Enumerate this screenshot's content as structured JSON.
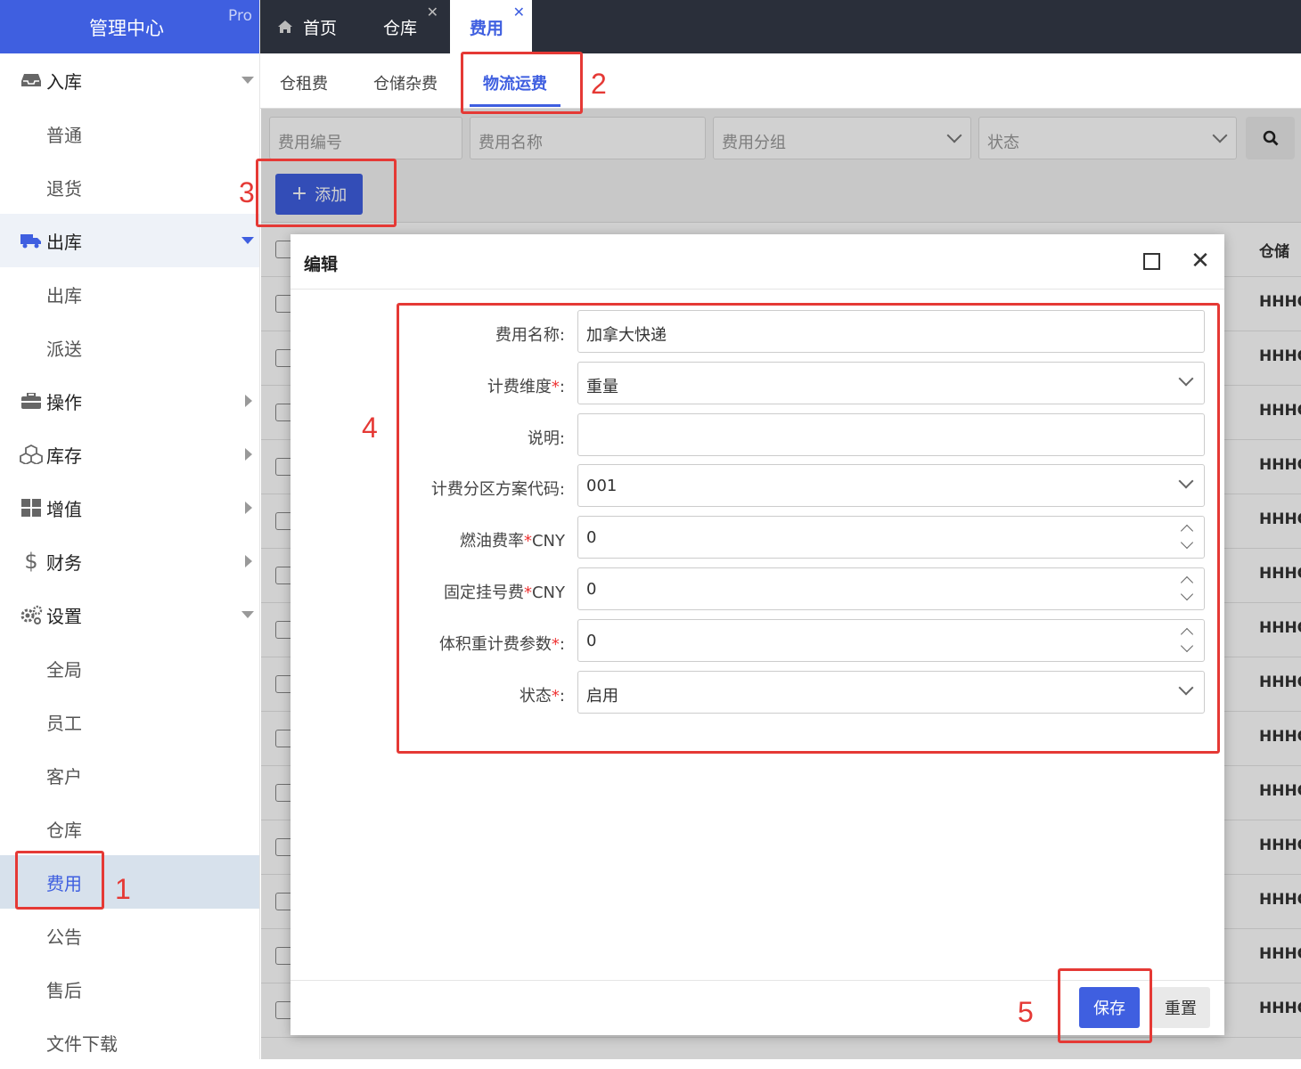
{
  "brand": {
    "title": "管理中心",
    "badge": "Pro"
  },
  "sidebar": {
    "groups": [
      {
        "label": "入库",
        "icon": "inbox-icon",
        "expanded": true,
        "children": [
          "普通",
          "退货"
        ]
      },
      {
        "label": "出库",
        "icon": "truck-icon",
        "expanded": true,
        "active": true,
        "children": [
          "出库",
          "派送"
        ]
      },
      {
        "label": "操作",
        "icon": "briefcase-icon",
        "expanded": false,
        "children": []
      },
      {
        "label": "库存",
        "icon": "cubes-icon",
        "expanded": false,
        "children": []
      },
      {
        "label": "增值",
        "icon": "grid-icon",
        "expanded": false,
        "children": []
      },
      {
        "label": "财务",
        "icon": "dollar-icon",
        "expanded": false,
        "children": []
      },
      {
        "label": "设置",
        "icon": "gears-icon",
        "expanded": true,
        "children": [
          "全局",
          "员工",
          "客户",
          "仓库",
          "费用",
          "公告",
          "售后",
          "文件下载"
        ],
        "selected_child": "费用"
      }
    ]
  },
  "top_tabs": [
    {
      "label": "首页",
      "icon": "home-icon",
      "closable": false
    },
    {
      "label": "仓库",
      "closable": true
    },
    {
      "label": "费用",
      "closable": true,
      "active": true
    }
  ],
  "sub_tabs": [
    {
      "label": "仓租费"
    },
    {
      "label": "仓储杂费"
    },
    {
      "label": "物流运费",
      "active": true
    }
  ],
  "filters": {
    "code_placeholder": "费用编号",
    "name_placeholder": "费用名称",
    "group_placeholder": "费用分组",
    "status_placeholder": "状态"
  },
  "toolbar": {
    "add_label": "添加"
  },
  "table": {
    "header_col": "仓储",
    "row_cell": "HHHC",
    "row_count": 14
  },
  "modal": {
    "title": "编辑",
    "fields": [
      {
        "label": "费用名称:",
        "required": false,
        "value": "加拿大快递",
        "kind": "text"
      },
      {
        "label": "计费维度",
        "required": true,
        "suffix": ":",
        "value": "重量",
        "kind": "select"
      },
      {
        "label": "说明:",
        "required": false,
        "value": "",
        "kind": "text"
      },
      {
        "label": "计费分区方案代码:",
        "required": false,
        "value": "001",
        "kind": "select"
      },
      {
        "label": "燃油费率",
        "required": true,
        "suffix": "CNY",
        "value": "0",
        "kind": "number"
      },
      {
        "label": "固定挂号费",
        "required": true,
        "suffix": "CNY",
        "value": "0",
        "kind": "number"
      },
      {
        "label": "体积重计费参数",
        "required": true,
        "suffix": ":",
        "value": "0",
        "kind": "number"
      },
      {
        "label": "状态",
        "required": true,
        "suffix": ":",
        "value": "启用",
        "kind": "select"
      }
    ],
    "save_label": "保存",
    "reset_label": "重置"
  },
  "annotations": [
    "1",
    "2",
    "3",
    "4",
    "5"
  ],
  "colors": {
    "accent": "#3f5fe0",
    "annotation": "#e53935",
    "topbar": "#2a2f3a"
  }
}
